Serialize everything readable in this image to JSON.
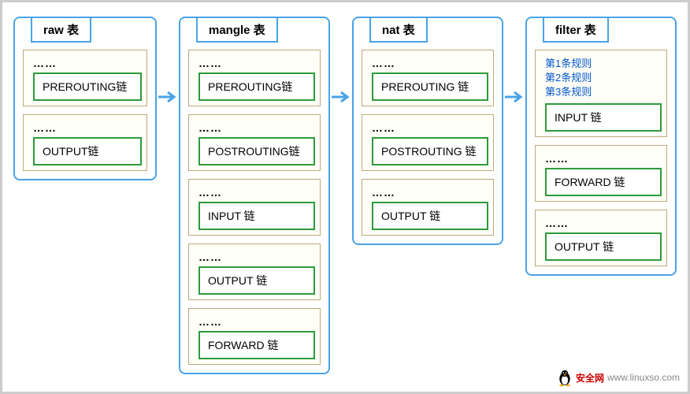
{
  "tables": [
    {
      "title": "raw 表",
      "chains": [
        {
          "dots": "……",
          "label": "PREROUTING链"
        },
        {
          "dots": "……",
          "label": "OUTPUT链"
        }
      ]
    },
    {
      "title": "mangle 表",
      "chains": [
        {
          "dots": "……",
          "label": "PREROUTING链"
        },
        {
          "dots": "……",
          "label": "POSTROUTING链"
        },
        {
          "dots": "……",
          "label": "INPUT 链"
        },
        {
          "dots": "……",
          "label": "OUTPUT 链"
        },
        {
          "dots": "……",
          "label": "FORWARD 链"
        }
      ]
    },
    {
      "title": "nat 表",
      "chains": [
        {
          "dots": "……",
          "label": "PREROUTING 链"
        },
        {
          "dots": "……",
          "label": "POSTROUTING 链"
        },
        {
          "dots": "……",
          "label": "OUTPUT 链"
        }
      ]
    },
    {
      "title": "filter 表",
      "chains": [
        {
          "rules": [
            "第1条规则",
            "第2条规则",
            "第3条规则"
          ],
          "label": "INPUT 链"
        },
        {
          "dots": "……",
          "label": "FORWARD 链"
        },
        {
          "dots": "……",
          "label": "OUTPUT 链"
        }
      ]
    }
  ],
  "watermark": {
    "site": "安全网",
    "url": "www.linuxso.com"
  }
}
